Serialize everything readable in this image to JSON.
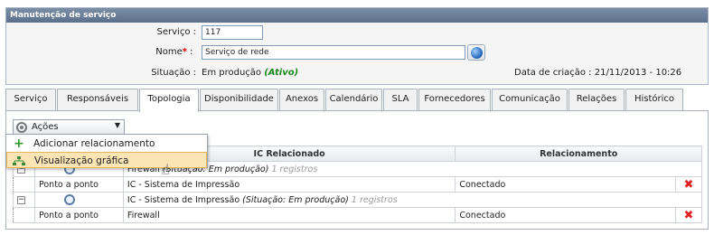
{
  "panel": {
    "title": "Manutenção de serviço",
    "servico_label": "Serviço :",
    "servico_value": "117",
    "nome_label": "Nome",
    "nome_required": "*",
    "nome_colon": ":",
    "nome_value": "Serviço de rede",
    "situacao_label": "Situação :",
    "situacao_value": "Em produção",
    "situacao_status": "(Ativo)",
    "created_label": "Data de criação :",
    "created_value": "21/11/2013 - 10:26"
  },
  "tabs": [
    {
      "label": "Serviço"
    },
    {
      "label": "Responsáveis"
    },
    {
      "label": "Topologia"
    },
    {
      "label": "Disponibilidade"
    },
    {
      "label": "Anexos"
    },
    {
      "label": "Calendário"
    },
    {
      "label": "SLA"
    },
    {
      "label": "Fornecedores"
    },
    {
      "label": "Comunicação"
    },
    {
      "label": "Relações"
    },
    {
      "label": "Histórico"
    }
  ],
  "actions": {
    "label": "Ações",
    "menu": [
      {
        "label": "Adicionar relacionamento"
      },
      {
        "label": "Visualização gráfica"
      }
    ]
  },
  "table": {
    "headers": [
      "IC Relacionado",
      "Relacionamento"
    ],
    "rows": [
      {
        "type": "group",
        "ic": "Firewall",
        "situacao": "(Situação: Em produção)",
        "count": "1 registros"
      },
      {
        "type": "item",
        "kind": "Ponto a ponto",
        "ic": "IC - Sistema de Impressão",
        "rel": "Conectado"
      },
      {
        "type": "group",
        "ic": "IC - Sistema de Impressão",
        "situacao": "(Situação: Em produção)",
        "count": "1 registros"
      },
      {
        "type": "item",
        "kind": "Ponto a ponto",
        "ic": "Firewall",
        "rel": "Conectado"
      }
    ]
  },
  "colors": {
    "header_bar": "#5b708b",
    "active_status": "#1c8a1c",
    "delete": "#e02020",
    "menu_highlight": "#fbe5b5"
  },
  "icons": [
    "globe-icon",
    "gear-icon",
    "plus-icon",
    "graph-icon",
    "magnifier-icon",
    "delete-icon",
    "expand-icon",
    "hand-cursor-icon"
  ]
}
